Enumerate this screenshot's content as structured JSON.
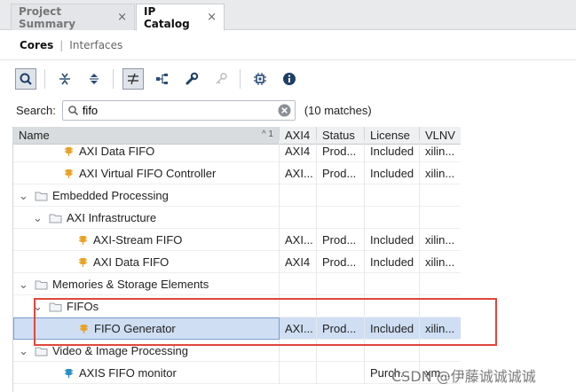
{
  "tabs": [
    {
      "label": "Project Summary",
      "close": "×"
    },
    {
      "label": "IP Catalog",
      "close": "×"
    }
  ],
  "subtabs": {
    "cores": "Cores",
    "separator": "|",
    "interfaces": "Interfaces"
  },
  "toolbar_icons": [
    "search-icon",
    "collapse-all-icon",
    "expand-all-icon",
    "filter-icon",
    "hierarchy-icon",
    "wrench-icon",
    "key-icon",
    "chip-icon",
    "info-icon"
  ],
  "search": {
    "label": "Search:",
    "value": "fifo",
    "matches": "(10 matches)"
  },
  "table": {
    "headers": {
      "name": "Name",
      "sort": "^ 1",
      "axi4": "AXI4",
      "status": "Status",
      "license": "License",
      "vlnv": "VLNV"
    },
    "rows": [
      {
        "type": "ip",
        "indent": 3,
        "name": "AXI Data FIFO",
        "axi4": "AXI4",
        "status": "Prod...",
        "license": "Included",
        "vlnv": "xilin..."
      },
      {
        "type": "ip",
        "indent": 3,
        "name": "AXI Virtual FIFO Controller",
        "axi4": "AXI...",
        "status": "Prod...",
        "license": "Included",
        "vlnv": "xilin..."
      },
      {
        "type": "folder",
        "indent": 1,
        "name": "Embedded Processing",
        "axi4": "",
        "status": "",
        "license": "",
        "vlnv": ""
      },
      {
        "type": "folder",
        "indent": 2,
        "name": "AXI Infrastructure",
        "axi4": "",
        "status": "",
        "license": "",
        "vlnv": ""
      },
      {
        "type": "ip",
        "indent": 4,
        "name": "AXI-Stream FIFO",
        "axi4": "AXI...",
        "status": "Prod...",
        "license": "Included",
        "vlnv": "xilin..."
      },
      {
        "type": "ip",
        "indent": 4,
        "name": "AXI Data FIFO",
        "axi4": "AXI4",
        "status": "Prod...",
        "license": "Included",
        "vlnv": "xilin..."
      },
      {
        "type": "folder",
        "indent": 1,
        "name": "Memories & Storage Elements",
        "axi4": "",
        "status": "",
        "license": "",
        "vlnv": ""
      },
      {
        "type": "folder",
        "indent": 2,
        "name": "FIFOs",
        "axi4": "",
        "status": "",
        "license": "",
        "vlnv": ""
      },
      {
        "type": "ip",
        "indent": 4,
        "name": "FIFO Generator",
        "axi4": "AXI...",
        "status": "Prod...",
        "license": "Included",
        "vlnv": "xilin...",
        "selected": true
      },
      {
        "type": "folder",
        "indent": 1,
        "name": "Video & Image Processing",
        "axi4": "",
        "status": "",
        "license": "",
        "vlnv": ""
      },
      {
        "type": "ip-blue",
        "indent": 3,
        "name": "AXIS FIFO monitor",
        "axi4": "",
        "status": "",
        "license": "Purch...",
        "vlnv": "xm..."
      }
    ]
  },
  "watermark": "CSDN @伊藤诚诚诚诚",
  "colors": {
    "highlight": "#e0463d",
    "selected_row": "#cfdef3",
    "ip_icon": "#e9a227"
  }
}
